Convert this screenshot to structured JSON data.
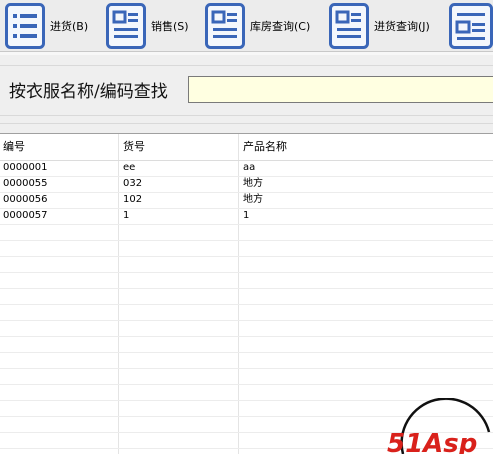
{
  "toolbar": {
    "buttons": [
      {
        "label": "进货(B)",
        "icon": "document-list-icon"
      },
      {
        "label": "销售(S)",
        "icon": "document-icon"
      },
      {
        "label": "库房查询(C)",
        "icon": "document-icon"
      },
      {
        "label": "进货查询(J)",
        "icon": "document-icon"
      },
      {
        "label": "",
        "icon": "form-icon"
      }
    ]
  },
  "search": {
    "label": "按衣服名称/编码查找",
    "value": ""
  },
  "grid": {
    "columns": [
      "编号",
      "货号",
      "产品名称"
    ],
    "rows": [
      [
        "0000001",
        "ee",
        "aa"
      ],
      [
        "0000055",
        "032",
        "地方"
      ],
      [
        "0000056",
        "102",
        "地方"
      ],
      [
        "0000057",
        "1",
        "1"
      ]
    ]
  },
  "watermark": {
    "text": "51Asp"
  },
  "colors": {
    "icon_blue": "#3a66b8",
    "icon_bg": "#f4f7fc",
    "toolbar_bg": "#ececec",
    "input_bg": "#ffffe1",
    "watermark_red": "#d9211b"
  }
}
